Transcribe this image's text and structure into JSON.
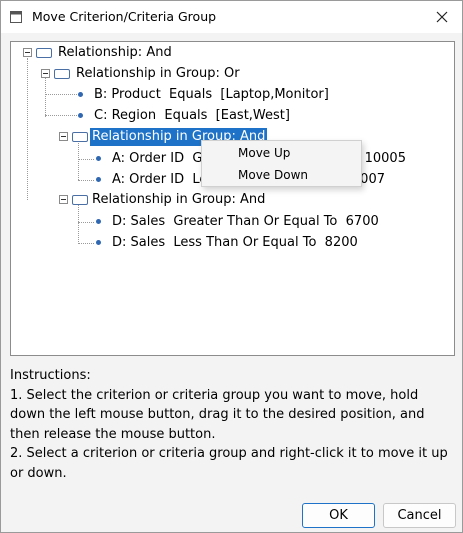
{
  "window": {
    "title": "Move Criterion/Criteria Group",
    "app_icon": "window-app-icon",
    "close_icon": "close-icon"
  },
  "tree": {
    "root": {
      "label": "Relationship: And"
    },
    "group1": {
      "label": "Relationship in Group: Or"
    },
    "group1_items": [
      {
        "label": "B: Product  Equals  [Laptop,Monitor]"
      },
      {
        "label": "C: Region  Equals  [East,West]"
      }
    ],
    "group2": {
      "label": "Relationship in Group: And",
      "selected": true
    },
    "group2_items": [
      {
        "label": "A: Order ID  Greater Than Or Equal To  10005"
      },
      {
        "label": "A: Order ID  Less Than Or Equal To  10007"
      }
    ],
    "group3": {
      "label": "Relationship in Group: And"
    },
    "group3_items": [
      {
        "label": "D: Sales  Greater Than Or Equal To  6700"
      },
      {
        "label": "D: Sales  Less Than Or Equal To  8200"
      }
    ]
  },
  "context_menu": {
    "move_up": "Move Up",
    "move_down": "Move Down"
  },
  "instructions": {
    "heading": "Instructions:",
    "line1": "1. Select the criterion or criteria group you want to move, hold down the left mouse button, drag it to the desired position, and then release the mouse button.",
    "line2": "2. Select a criterion or criteria group and right-click it to move it up or down."
  },
  "buttons": {
    "ok": "OK",
    "cancel": "Cancel"
  },
  "colors": {
    "selection": "#1e73c8",
    "bullet": "#2f67b1",
    "group_icon_border": "#4a6fa5"
  }
}
